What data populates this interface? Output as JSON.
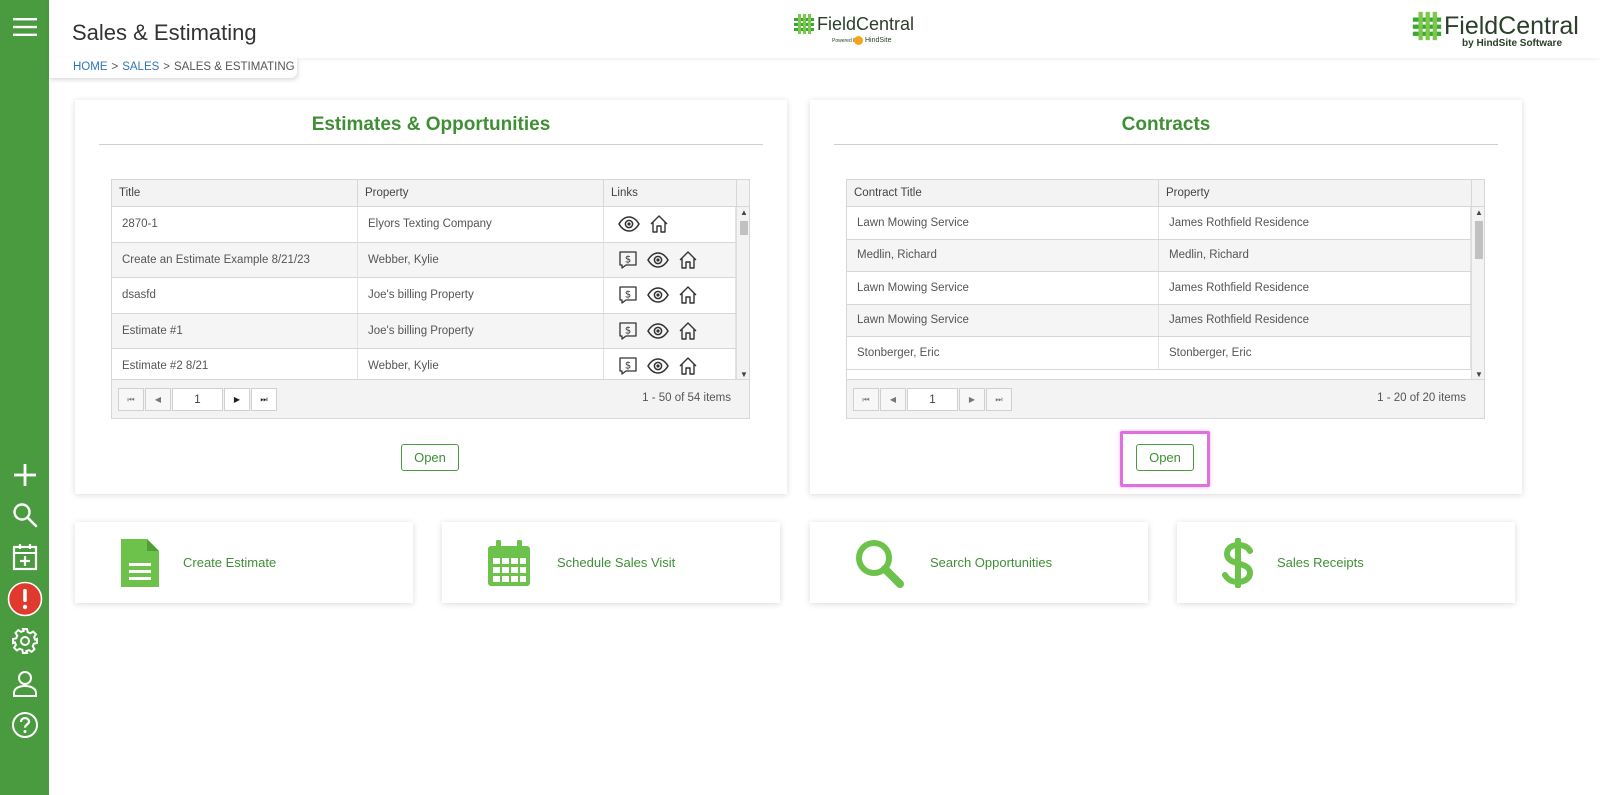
{
  "header": {
    "title": "Sales & Estimating",
    "breadcrumb": [
      "HOME",
      "SALES",
      "SALES & ESTIMATING"
    ],
    "breadcrumb_sep": ">",
    "logo_center": {
      "text": "FieldCentral",
      "powered": "Powered By",
      "brand": "HindSite"
    },
    "logo_right": {
      "text": "FieldCentral",
      "tagline": "by HindSite Software"
    }
  },
  "sidebar": {
    "icons": [
      "menu-icon",
      "plus-icon",
      "search-icon",
      "calendar-add-icon",
      "alert-icon",
      "gear-icon",
      "user-icon",
      "help-icon"
    ]
  },
  "estimates": {
    "title": "Estimates & Opportunities",
    "columns": [
      "Title",
      "Property",
      "Links"
    ],
    "rows": [
      {
        "title": "2870-1",
        "property": "Elyors Texting Company",
        "links": [
          "eye",
          "home"
        ]
      },
      {
        "title": "Create an Estimate Example 8/21/23",
        "property": "Webber, Kylie",
        "links": [
          "dollar",
          "eye",
          "home"
        ]
      },
      {
        "title": "dsasfd",
        "property": "Joe's billing Property",
        "links": [
          "dollar",
          "eye",
          "home"
        ]
      },
      {
        "title": "Estimate #1",
        "property": "Joe's billing Property",
        "links": [
          "dollar",
          "eye",
          "home"
        ]
      },
      {
        "title": "Estimate #2 8/21",
        "property": "Webber, Kylie",
        "links": [
          "dollar",
          "eye",
          "home"
        ]
      }
    ],
    "page": "1",
    "info": "1 - 50 of 54 items",
    "open_label": "Open"
  },
  "contracts": {
    "title": "Contracts",
    "columns": [
      "Contract Title",
      "Property"
    ],
    "rows": [
      {
        "title": "Lawn Mowing Service",
        "property": "James Rothfield Residence"
      },
      {
        "title": "Medlin, Richard",
        "property": "Medlin, Richard"
      },
      {
        "title": "Lawn Mowing Service",
        "property": "James Rothfield Residence"
      },
      {
        "title": "Lawn Mowing Service",
        "property": "James Rothfield Residence"
      },
      {
        "title": "Stonberger, Eric",
        "property": "Stonberger, Eric"
      }
    ],
    "page": "1",
    "info": "1 - 20 of 20 items",
    "open_label": "Open"
  },
  "actions": [
    {
      "label": "Create Estimate",
      "icon": "document-icon"
    },
    {
      "label": "Schedule Sales Visit",
      "icon": "calendar-icon"
    },
    {
      "label": "Search Opportunities",
      "icon": "search-icon"
    },
    {
      "label": "Sales Receipts",
      "icon": "dollar-icon"
    }
  ],
  "colors": {
    "sidebar": "#4a9a3f",
    "accent": "#3f8f35",
    "icon_green": "#6cc24a",
    "alert": "#e03a2f",
    "highlight": "#e070e0",
    "link": "#2f77b5"
  }
}
